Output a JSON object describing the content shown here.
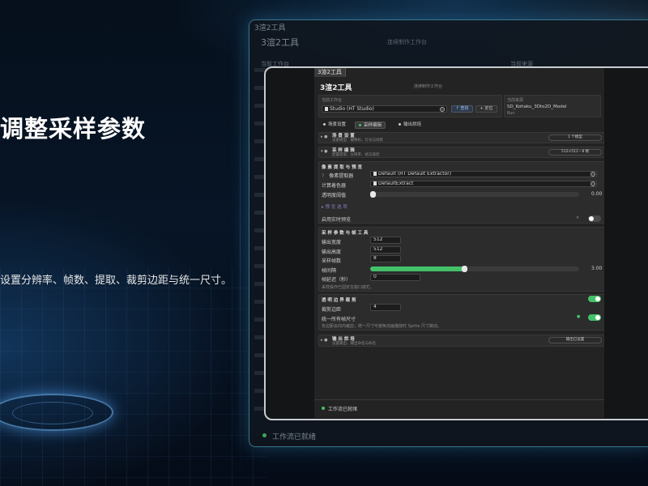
{
  "hero": {
    "title": "调整采样参数",
    "description": "设置分辨率、帧数、提取、裁剪边距与统一尺寸。"
  },
  "background_window": {
    "tab": "3渲2工具",
    "title": "3渲2工具",
    "subtitle": "连续制作工作台",
    "label_workbench": "当前工作台",
    "label_source": "当前来源",
    "status": "工作流已就绪"
  },
  "app": {
    "tab": "3渲2工具",
    "title": "3渲2工具",
    "subtitle": "连续制作工作台",
    "workbench": {
      "label": "当前工作台",
      "value": "Studio (HT Studio)",
      "find_button": "查找",
      "locate_button": "定位"
    },
    "source": {
      "label": "当前来源",
      "value": "SD_Kohaku_3Dto2D_Model",
      "sub": "Run"
    },
    "tabs": [
      "场景设置",
      "采样编辑",
      "输出烘培"
    ],
    "active_tab": 1,
    "scene_section": {
      "title": "场 景 设 置",
      "sub": "准备模型、摄像机、灯光与场景",
      "pill": "1 个模型"
    },
    "sample_section": {
      "title": "采 样 编 辑",
      "sub": "配置提取、分辨率、帧与裁剪",
      "pill": "512×512・8 帧"
    },
    "extract": {
      "header": "像 素 提 取 与 预 览",
      "extractor_label": "像素提取器",
      "extractor_value": "Default (HT Default Extractor)",
      "shader_label": "计算着色器",
      "shader_value": "DefaultExtract",
      "alpha_label": "透明度阈值",
      "alpha_value": "0.00",
      "alpha_fraction": 0.0,
      "preview_options": "预 览 选 项",
      "realtime_label": "启用实时预览",
      "realtime_on": false
    },
    "sampling": {
      "header": "采 样 参 数 与 帧 工 具",
      "width_label": "输出宽度",
      "width_value": "512",
      "height_label": "输出高度",
      "height_value": "512",
      "frames_label": "采样帧数",
      "frames_value": "8",
      "spacing_label": "帧间隔",
      "spacing_value": "3.00",
      "spacing_fraction": 0.45,
      "delay_label": "帧延迟（秒）",
      "delay_value": "0",
      "hint": "采样操作已固定在窗口底栏。"
    },
    "trim": {
      "header": "透 明 边 界 裁 剪",
      "trim_on": true,
      "margin_label": "裁剪边距",
      "margin_value": "4",
      "uniform_label": "统一所有帧尺寸",
      "uniform_on": true,
      "hint": "负边距会向内裁剪；统一尺寸可避免动画播放时 Sprite 尺寸跳动。"
    },
    "output_section": {
      "title": "输 出 烘 培",
      "sub": "设置输出、输出命名与命名",
      "pill": "输出已设置"
    },
    "status": "工作流已就绪"
  },
  "colors": {
    "accent_green": "#45c16a",
    "link_blue": "#9fc7ff",
    "frame_border": "#c9ccd0",
    "panel_glow": "#5ac8e6"
  }
}
